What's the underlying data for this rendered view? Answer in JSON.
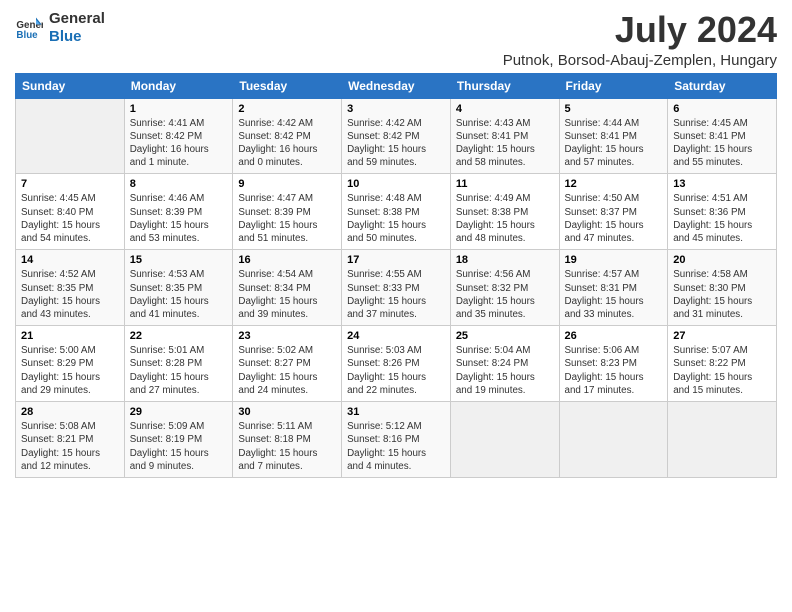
{
  "logo": {
    "line1": "General",
    "line2": "Blue"
  },
  "header": {
    "month": "July 2024",
    "location": "Putnok, Borsod-Abauj-Zemplen, Hungary"
  },
  "columns": [
    "Sunday",
    "Monday",
    "Tuesday",
    "Wednesday",
    "Thursday",
    "Friday",
    "Saturday"
  ],
  "weeks": [
    [
      {
        "day": "",
        "info": ""
      },
      {
        "day": "1",
        "info": "Sunrise: 4:41 AM\nSunset: 8:42 PM\nDaylight: 16 hours\nand 1 minute."
      },
      {
        "day": "2",
        "info": "Sunrise: 4:42 AM\nSunset: 8:42 PM\nDaylight: 16 hours\nand 0 minutes."
      },
      {
        "day": "3",
        "info": "Sunrise: 4:42 AM\nSunset: 8:42 PM\nDaylight: 15 hours\nand 59 minutes."
      },
      {
        "day": "4",
        "info": "Sunrise: 4:43 AM\nSunset: 8:41 PM\nDaylight: 15 hours\nand 58 minutes."
      },
      {
        "day": "5",
        "info": "Sunrise: 4:44 AM\nSunset: 8:41 PM\nDaylight: 15 hours\nand 57 minutes."
      },
      {
        "day": "6",
        "info": "Sunrise: 4:45 AM\nSunset: 8:41 PM\nDaylight: 15 hours\nand 55 minutes."
      }
    ],
    [
      {
        "day": "7",
        "info": "Sunrise: 4:45 AM\nSunset: 8:40 PM\nDaylight: 15 hours\nand 54 minutes."
      },
      {
        "day": "8",
        "info": "Sunrise: 4:46 AM\nSunset: 8:39 PM\nDaylight: 15 hours\nand 53 minutes."
      },
      {
        "day": "9",
        "info": "Sunrise: 4:47 AM\nSunset: 8:39 PM\nDaylight: 15 hours\nand 51 minutes."
      },
      {
        "day": "10",
        "info": "Sunrise: 4:48 AM\nSunset: 8:38 PM\nDaylight: 15 hours\nand 50 minutes."
      },
      {
        "day": "11",
        "info": "Sunrise: 4:49 AM\nSunset: 8:38 PM\nDaylight: 15 hours\nand 48 minutes."
      },
      {
        "day": "12",
        "info": "Sunrise: 4:50 AM\nSunset: 8:37 PM\nDaylight: 15 hours\nand 47 minutes."
      },
      {
        "day": "13",
        "info": "Sunrise: 4:51 AM\nSunset: 8:36 PM\nDaylight: 15 hours\nand 45 minutes."
      }
    ],
    [
      {
        "day": "14",
        "info": "Sunrise: 4:52 AM\nSunset: 8:35 PM\nDaylight: 15 hours\nand 43 minutes."
      },
      {
        "day": "15",
        "info": "Sunrise: 4:53 AM\nSunset: 8:35 PM\nDaylight: 15 hours\nand 41 minutes."
      },
      {
        "day": "16",
        "info": "Sunrise: 4:54 AM\nSunset: 8:34 PM\nDaylight: 15 hours\nand 39 minutes."
      },
      {
        "day": "17",
        "info": "Sunrise: 4:55 AM\nSunset: 8:33 PM\nDaylight: 15 hours\nand 37 minutes."
      },
      {
        "day": "18",
        "info": "Sunrise: 4:56 AM\nSunset: 8:32 PM\nDaylight: 15 hours\nand 35 minutes."
      },
      {
        "day": "19",
        "info": "Sunrise: 4:57 AM\nSunset: 8:31 PM\nDaylight: 15 hours\nand 33 minutes."
      },
      {
        "day": "20",
        "info": "Sunrise: 4:58 AM\nSunset: 8:30 PM\nDaylight: 15 hours\nand 31 minutes."
      }
    ],
    [
      {
        "day": "21",
        "info": "Sunrise: 5:00 AM\nSunset: 8:29 PM\nDaylight: 15 hours\nand 29 minutes."
      },
      {
        "day": "22",
        "info": "Sunrise: 5:01 AM\nSunset: 8:28 PM\nDaylight: 15 hours\nand 27 minutes."
      },
      {
        "day": "23",
        "info": "Sunrise: 5:02 AM\nSunset: 8:27 PM\nDaylight: 15 hours\nand 24 minutes."
      },
      {
        "day": "24",
        "info": "Sunrise: 5:03 AM\nSunset: 8:26 PM\nDaylight: 15 hours\nand 22 minutes."
      },
      {
        "day": "25",
        "info": "Sunrise: 5:04 AM\nSunset: 8:24 PM\nDaylight: 15 hours\nand 19 minutes."
      },
      {
        "day": "26",
        "info": "Sunrise: 5:06 AM\nSunset: 8:23 PM\nDaylight: 15 hours\nand 17 minutes."
      },
      {
        "day": "27",
        "info": "Sunrise: 5:07 AM\nSunset: 8:22 PM\nDaylight: 15 hours\nand 15 minutes."
      }
    ],
    [
      {
        "day": "28",
        "info": "Sunrise: 5:08 AM\nSunset: 8:21 PM\nDaylight: 15 hours\nand 12 minutes."
      },
      {
        "day": "29",
        "info": "Sunrise: 5:09 AM\nSunset: 8:19 PM\nDaylight: 15 hours\nand 9 minutes."
      },
      {
        "day": "30",
        "info": "Sunrise: 5:11 AM\nSunset: 8:18 PM\nDaylight: 15 hours\nand 7 minutes."
      },
      {
        "day": "31",
        "info": "Sunrise: 5:12 AM\nSunset: 8:16 PM\nDaylight: 15 hours\nand 4 minutes."
      },
      {
        "day": "",
        "info": ""
      },
      {
        "day": "",
        "info": ""
      },
      {
        "day": "",
        "info": ""
      }
    ]
  ]
}
